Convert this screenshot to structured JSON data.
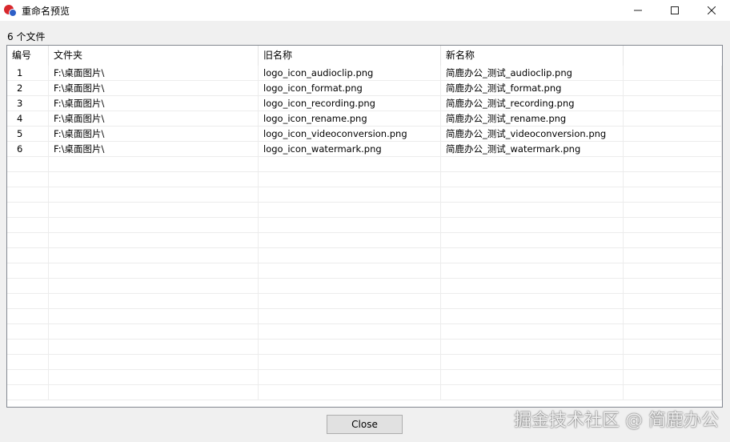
{
  "window": {
    "title": "重命名预览"
  },
  "file_count_label": "6 个文件",
  "table": {
    "columns": [
      "编号",
      "文件夹",
      "旧名称",
      "新名称"
    ],
    "rows": [
      [
        "1",
        "F:\\桌面图片\\",
        "logo_icon_audioclip.png",
        "简鹿办公_测试_audioclip.png"
      ],
      [
        "2",
        "F:\\桌面图片\\",
        "logo_icon_format.png",
        "简鹿办公_测试_format.png"
      ],
      [
        "3",
        "F:\\桌面图片\\",
        "logo_icon_recording.png",
        "简鹿办公_测试_recording.png"
      ],
      [
        "4",
        "F:\\桌面图片\\",
        "logo_icon_rename.png",
        "简鹿办公_测试_rename.png"
      ],
      [
        "5",
        "F:\\桌面图片\\",
        "logo_icon_videoconversion.png",
        "简鹿办公_测试_videoconversion.png"
      ],
      [
        "6",
        "F:\\桌面图片\\",
        "logo_icon_watermark.png",
        "简鹿办公_测试_watermark.png"
      ]
    ]
  },
  "close_button_label": "Close",
  "watermark_text": "掘金技术社区 @ 简鹿办公",
  "colors": {
    "app_icon_red": "#d8282d",
    "app_icon_blue": "#2d5fc7"
  }
}
